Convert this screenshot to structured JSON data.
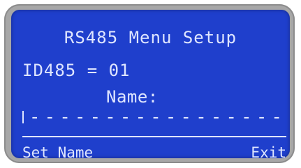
{
  "screen": {
    "title": "RS485 Menu Setup",
    "id_line": "ID485 = 01",
    "name_label": "Name:",
    "name_value": "-----------------"
  },
  "softkeys": {
    "left": "Set Name",
    "right": "Exit"
  },
  "colors": {
    "lcd_background": "#1f3fcc",
    "lcd_text": "#dfe6ff",
    "bezel": "#a7a7a7"
  }
}
